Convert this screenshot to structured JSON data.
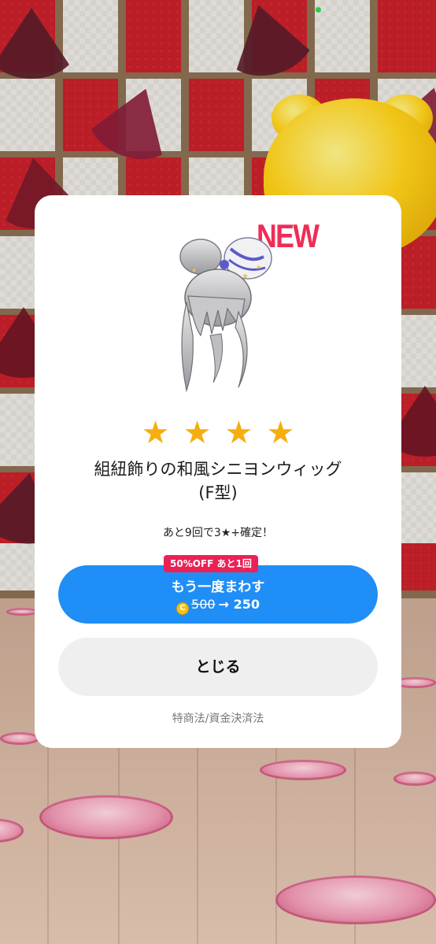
{
  "modal": {
    "new_badge": "NEW",
    "stars": [
      "★",
      "★",
      "★",
      "★"
    ],
    "star_count": 4,
    "item_name_line1": "組紐飾りの和風シニヨンウィッグ",
    "item_name_line2": "(F型)",
    "guarantee_notice": "あと9回で3★+確定！",
    "discount_badge": "50%OFF あと1回",
    "spin_again": {
      "label": "もう一度まわす",
      "coin_glyph": "C",
      "old_price": "500",
      "arrow": "→",
      "new_price": "250"
    },
    "close_label": "とじる",
    "legal_link": "特商法/資金決済法"
  },
  "colors": {
    "accent_blue": "#1f8ef7",
    "badge_red": "#ea2256",
    "star_gold": "#f6ad0e",
    "new_pink": "#ee2d56"
  },
  "icons": {
    "coin": "coin-icon",
    "star": "star-icon"
  }
}
